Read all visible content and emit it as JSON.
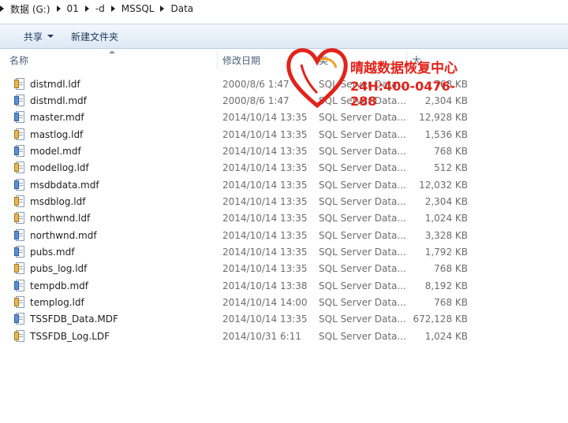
{
  "address_bar": {
    "segments": [
      "数据 (G:)",
      "01",
      "-d",
      "MSSQL",
      "Data"
    ]
  },
  "toolbar": {
    "share_label": "共享",
    "new_folder_label": "新建文件夹"
  },
  "columns": {
    "name": "名称",
    "date": "修改日期",
    "type": "类",
    "size": "大"
  },
  "files": [
    {
      "name": "distmdl.ldf",
      "date": "2000/8/6 1:47",
      "type": "SQL Server Data...",
      "size": "768 KB",
      "icon": "ldf-icon"
    },
    {
      "name": "distmdl.mdf",
      "date": "2000/8/6 1:47",
      "type": "SQL Server Data...",
      "size": "2,304 KB",
      "icon": "mdf-icon"
    },
    {
      "name": "master.mdf",
      "date": "2014/10/14 13:35",
      "type": "SQL Server Data...",
      "size": "12,928 KB",
      "icon": "mdf-icon"
    },
    {
      "name": "mastlog.ldf",
      "date": "2014/10/14 13:35",
      "type": "SQL Server Data...",
      "size": "1,536 KB",
      "icon": "ldf-icon"
    },
    {
      "name": "model.mdf",
      "date": "2014/10/14 13:35",
      "type": "SQL Server Data...",
      "size": "768 KB",
      "icon": "mdf-icon"
    },
    {
      "name": "modellog.ldf",
      "date": "2014/10/14 13:35",
      "type": "SQL Server Data...",
      "size": "512 KB",
      "icon": "ldf-icon"
    },
    {
      "name": "msdbdata.mdf",
      "date": "2014/10/14 13:35",
      "type": "SQL Server Data...",
      "size": "12,032 KB",
      "icon": "mdf-icon"
    },
    {
      "name": "msdblog.ldf",
      "date": "2014/10/14 13:35",
      "type": "SQL Server Data...",
      "size": "2,304 KB",
      "icon": "ldf-icon"
    },
    {
      "name": "northwnd.ldf",
      "date": "2014/10/14 13:35",
      "type": "SQL Server Data...",
      "size": "1,024 KB",
      "icon": "ldf-icon"
    },
    {
      "name": "northwnd.mdf",
      "date": "2014/10/14 13:35",
      "type": "SQL Server Data...",
      "size": "3,328 KB",
      "icon": "mdf-icon"
    },
    {
      "name": "pubs.mdf",
      "date": "2014/10/14 13:35",
      "type": "SQL Server Data...",
      "size": "1,792 KB",
      "icon": "mdf-icon"
    },
    {
      "name": "pubs_log.ldf",
      "date": "2014/10/14 13:35",
      "type": "SQL Server Data...",
      "size": "768 KB",
      "icon": "ldf-icon"
    },
    {
      "name": "tempdb.mdf",
      "date": "2014/10/14 13:38",
      "type": "SQL Server Data...",
      "size": "8,192 KB",
      "icon": "mdf-icon"
    },
    {
      "name": "templog.ldf",
      "date": "2014/10/14 14:00",
      "type": "SQL Server Data...",
      "size": "768 KB",
      "icon": "ldf-icon"
    },
    {
      "name": "TSSFDB_Data.MDF",
      "date": "2014/10/14 13:35",
      "type": "SQL Server Data...",
      "size": "672,128 KB",
      "icon": "mdf-icon"
    },
    {
      "name": "TSSFDB_Log.LDF",
      "date": "2014/10/31 6:11",
      "type": "SQL Server Data...",
      "size": "1,024 KB",
      "icon": "ldf-icon"
    }
  ],
  "watermark": {
    "company": "晴越数据恢复中心",
    "phone": "24H:400-0476-288",
    "color": "#e2231a"
  }
}
